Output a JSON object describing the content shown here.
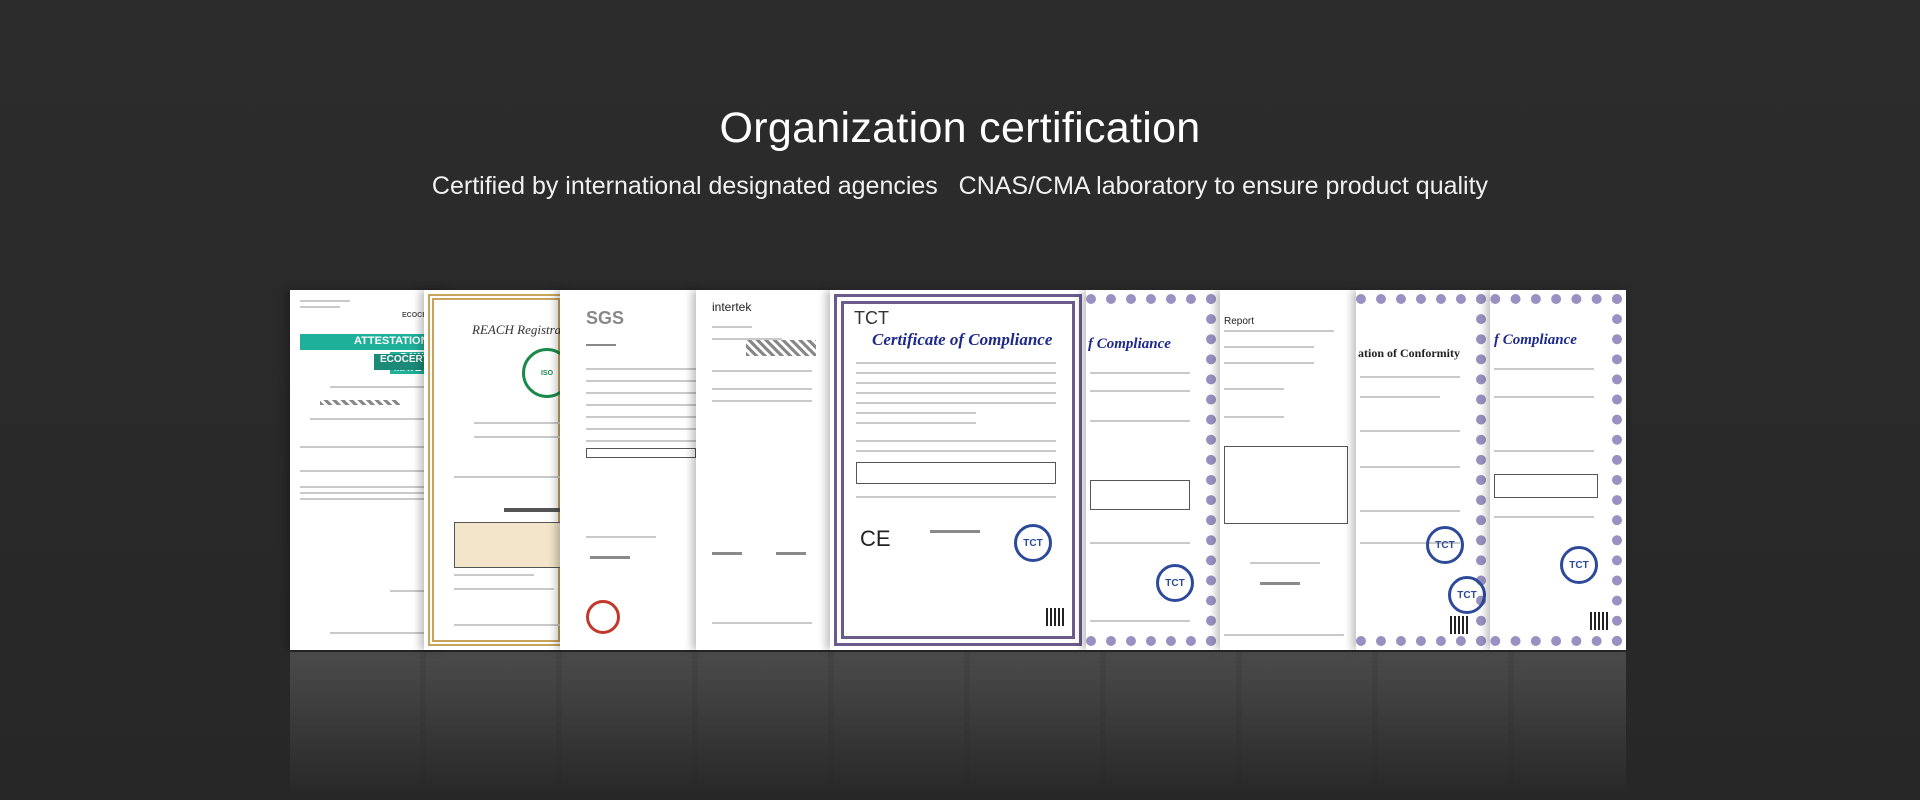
{
  "header": {
    "title": "Organization certification",
    "subtitle": "Certified by international designated agencies   CNAS/CMA laboratory to ensure product quality"
  },
  "certificates": [
    {
      "org": "ECOCERT",
      "heading": "ATTESTATION OF",
      "subheading": "- RAW MATE",
      "name": "ECOCERT CO"
    },
    {
      "org": "REACH",
      "heading": "REACH Registra"
    },
    {
      "org": "SGS",
      "heading": "SGS"
    },
    {
      "org": "Intertek",
      "heading": "intertek"
    },
    {
      "org": "TCT",
      "heading": "TCT",
      "title": "Certificate of Compliance"
    },
    {
      "org": "TCT",
      "title": "f Compliance"
    },
    {
      "org": "TCT",
      "title": "Report"
    },
    {
      "org": "TCT",
      "title": "ation of Conformity"
    },
    {
      "org": "TCT",
      "title": "f Compliance"
    }
  ],
  "colors": {
    "background": "#2a2a2a",
    "accent_teal": "#1fb09a",
    "tct_blue": "#1e2a8a",
    "frame_purple": "#6b5a8c"
  },
  "icons": [
    "tct-seal-icon",
    "ce-mark-icon",
    "qr-code-icon",
    "reach-seal-icon",
    "sgs-stamp-icon"
  ]
}
